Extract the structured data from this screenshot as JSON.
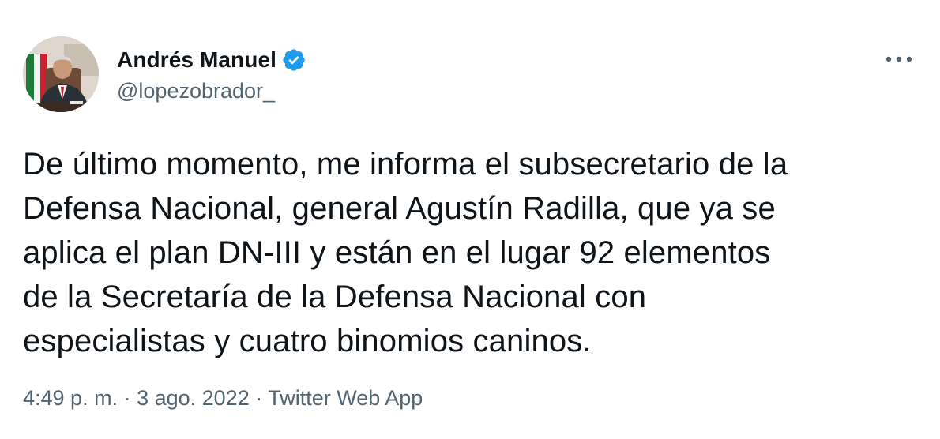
{
  "author": {
    "display_name": "Andrés Manuel",
    "handle": "@lopezobrador_",
    "verified": true,
    "avatar_icon": "profile-photo"
  },
  "more_icon": "more-horizontal-icon",
  "tweet": {
    "text_lines": [
      "De último momento, me informa el subsecretario de la",
      "Defensa Nacional, general Agustín Radilla, que ya se",
      "aplica el plan DN-III y están en el lugar 92 elementos",
      "de la Secretaría de la Defensa Nacional con",
      "especialistas y cuatro binomios caninos."
    ]
  },
  "meta": {
    "time": "4:49 p. m.",
    "separator": " · ",
    "date": "3 ago. 2022",
    "source": "Twitter Web App"
  },
  "colors": {
    "text_primary": "#0f1419",
    "text_secondary": "#536471",
    "verified_blue": "#1d9bf0"
  }
}
